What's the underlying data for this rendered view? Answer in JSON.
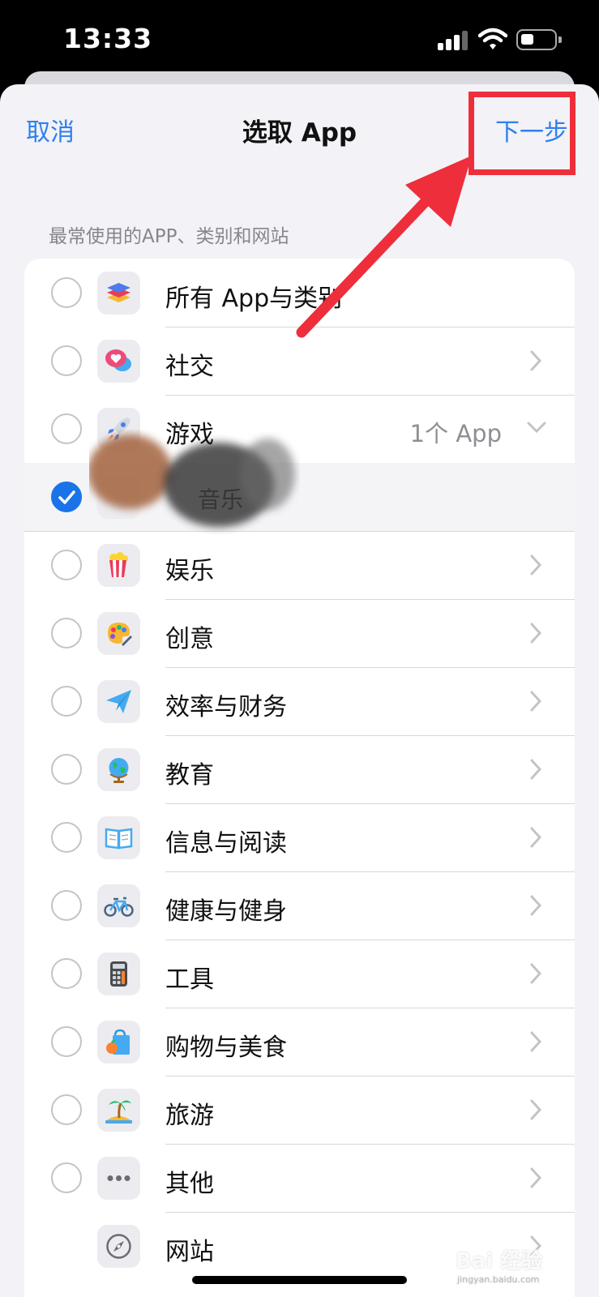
{
  "status": {
    "time": "13:33"
  },
  "nav": {
    "cancel": "取消",
    "title": "选取 App",
    "next": "下一步"
  },
  "section_header": "最常使用的APP、类别和网站",
  "rows": [
    {
      "label": "所有 App与类别",
      "icon": "stack-icon",
      "radio": "unchecked",
      "chevron": "none",
      "detail": ""
    },
    {
      "label": "社交",
      "icon": "chat-bubble-heart-icon",
      "radio": "unchecked",
      "chevron": "right",
      "detail": ""
    },
    {
      "label": "游戏",
      "icon": "rocket-icon",
      "radio": "unchecked",
      "chevron": "down",
      "detail": "1个 App"
    },
    {
      "label": "音乐",
      "icon": "app-icon",
      "radio": "checked",
      "chevron": "none",
      "detail": ""
    },
    {
      "label": "娱乐",
      "icon": "popcorn-icon",
      "radio": "unchecked",
      "chevron": "right",
      "detail": ""
    },
    {
      "label": "创意",
      "icon": "palette-icon",
      "radio": "unchecked",
      "chevron": "right",
      "detail": ""
    },
    {
      "label": "效率与财务",
      "icon": "paper-plane-icon",
      "radio": "unchecked",
      "chevron": "right",
      "detail": ""
    },
    {
      "label": "教育",
      "icon": "globe-icon",
      "radio": "unchecked",
      "chevron": "right",
      "detail": ""
    },
    {
      "label": "信息与阅读",
      "icon": "book-icon",
      "radio": "unchecked",
      "chevron": "right",
      "detail": ""
    },
    {
      "label": "健康与健身",
      "icon": "bicycle-icon",
      "radio": "unchecked",
      "chevron": "right",
      "detail": ""
    },
    {
      "label": "工具",
      "icon": "calculator-icon",
      "radio": "unchecked",
      "chevron": "right",
      "detail": ""
    },
    {
      "label": "购物与美食",
      "icon": "shopping-bag-icon",
      "radio": "unchecked",
      "chevron": "right",
      "detail": ""
    },
    {
      "label": "旅游",
      "icon": "palm-island-icon",
      "radio": "unchecked",
      "chevron": "right",
      "detail": ""
    },
    {
      "label": "其他",
      "icon": "ellipsis-icon",
      "radio": "unchecked",
      "chevron": "right",
      "detail": ""
    },
    {
      "label": "网站",
      "icon": "compass-icon",
      "radio": "none",
      "chevron": "right",
      "detail": ""
    }
  ],
  "watermark": {
    "brand": "Bai 经验",
    "url": "jingyan.baidu.com"
  },
  "colors": {
    "accent": "#2f80ed",
    "annotation": "#ee2e3b",
    "checked": "#1a73e8"
  }
}
